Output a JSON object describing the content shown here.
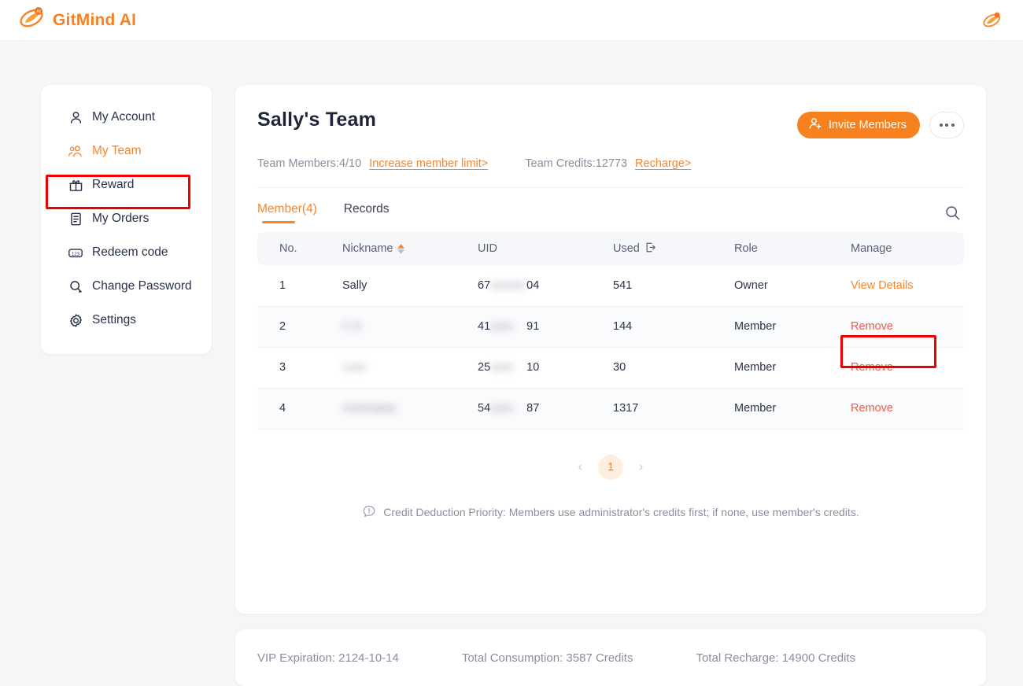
{
  "header": {
    "brand_name": "GitMind AI",
    "logo_icon": "gitmind-logo-icon",
    "avatar_icon": "gitmind-avatar-icon"
  },
  "sidebar": {
    "items": [
      {
        "label": "My Account",
        "icon": "user-icon",
        "active": false
      },
      {
        "label": "My Team",
        "icon": "team-icon",
        "active": true
      },
      {
        "label": "Reward",
        "icon": "gift-icon",
        "active": false
      },
      {
        "label": "My Orders",
        "icon": "document-icon",
        "active": false
      },
      {
        "label": "Redeem code",
        "icon": "numbers-123-icon",
        "active": false
      },
      {
        "label": "Change Password",
        "icon": "search-key-icon",
        "active": false
      },
      {
        "label": "Settings",
        "icon": "gear-icon",
        "active": false
      }
    ]
  },
  "main": {
    "title": "Sally's Team",
    "invite_button": "Invite Members",
    "invite_icon": "user-plus-icon",
    "more_button_icon": "ellipsis-icon",
    "stats": {
      "members_label": "Team Members:4/10",
      "members_link": "Increase member limit>",
      "credits_label": "Team Credits:12773",
      "credits_link": "Recharge>"
    },
    "tabs": [
      {
        "label": "Member(4)",
        "active": true
      },
      {
        "label": "Records",
        "active": false
      }
    ],
    "search_icon": "search-icon",
    "table": {
      "columns": [
        "No.",
        "Nickname",
        "UID",
        "Used",
        "Role",
        "Manage"
      ],
      "nickname_sort_icon": "sort-arrows-icon",
      "used_info_icon": "export-arrow-icon",
      "rows": [
        {
          "no": "1",
          "nickname": "Sally",
          "nickname_blurred": false,
          "uid_prefix": "67",
          "uid_mid": "xxxxxx",
          "uid_suffix": "04",
          "used": "541",
          "role": "Owner",
          "action": "View Details",
          "action_type": "view"
        },
        {
          "no": "2",
          "nickname": "C      S",
          "nickname_blurred": true,
          "uid_prefix": "41",
          "uid_mid": "xxxx",
          "uid_suffix": "91",
          "used": "144",
          "role": "Member",
          "action": "Remove",
          "action_type": "remove"
        },
        {
          "no": "3",
          "nickname": "Lxxx",
          "nickname_blurred": true,
          "uid_prefix": "25",
          "uid_mid": "xxxx",
          "uid_suffix": "10",
          "used": "30",
          "role": "Member",
          "action": "Remove",
          "action_type": "remove"
        },
        {
          "no": "4",
          "nickname": "momoqwq",
          "nickname_blurred": true,
          "uid_prefix": "54",
          "uid_mid": "xxxx",
          "uid_suffix": "87",
          "used": "1317",
          "role": "Member",
          "action": "Remove",
          "action_type": "remove"
        }
      ]
    },
    "pagination": {
      "prev_icon": "chevron-left-icon",
      "current_page": "1",
      "next_icon": "chevron-right-icon"
    },
    "note": {
      "icon": "info-circle-icon",
      "text": "Credit Deduction Priority: Members use administrator's credits first; if none, use member's credits."
    }
  },
  "bottom_bar": {
    "vip_expiration": "VIP Expiration: 2124-10-14",
    "total_consumption": "Total Consumption: 3587 Credits",
    "total_recharge": "Total Recharge: 14900 Credits"
  },
  "annotations": {
    "color": "#ee0000",
    "boxes": [
      "my-team-sidebar-item",
      "view-details-link"
    ]
  }
}
